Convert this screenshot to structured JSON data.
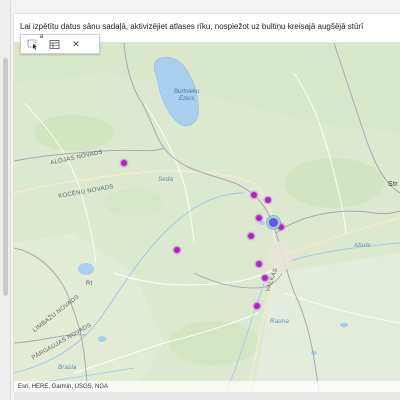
{
  "instruction": "Lai izpētītu datus sānu sadaļā, aktivizējiet atlases rīku, nospiežot uz bultiņu kreisajā augšējā stūrī",
  "toolbar": {
    "select_cursor_badge": "a",
    "items": [
      {
        "name": "select-tool",
        "icon": "selection-arrow-icon"
      },
      {
        "name": "table-tool",
        "icon": "table-icon"
      },
      {
        "name": "close-tool",
        "icon": "close-icon",
        "label": "✕"
      }
    ]
  },
  "map": {
    "labels": {
      "alojas": "ALOJAS NOVADS",
      "kocenu": "KOCĒNU NOVADS",
      "limbazu": "LIMBAŽU NOVADS",
      "pargaujas": "PĀRGAUJAS NOVADS",
      "valka": "VALKAS",
      "strenci": "Str",
      "lake": "Burtnieku\nEzers",
      "abuls": "Abuls",
      "seda": "Seda",
      "rauna": "Rauna",
      "brasla": "Brasla",
      "rt": "Rt"
    },
    "markers": [
      {
        "lat": 57.62,
        "lon": 24.95
      },
      {
        "lat": 57.55,
        "lon": 25.42
      },
      {
        "lat": 57.54,
        "lon": 25.47
      },
      {
        "lat": 57.5,
        "lon": 25.44
      },
      {
        "lat": 57.49,
        "lon": 25.5
      },
      {
        "lat": 57.48,
        "lon": 25.52
      },
      {
        "lat": 57.46,
        "lon": 25.41
      },
      {
        "lat": 57.43,
        "lon": 25.14
      },
      {
        "lat": 57.4,
        "lon": 25.44
      },
      {
        "lat": 57.37,
        "lon": 25.46
      },
      {
        "lat": 57.31,
        "lon": 25.43
      }
    ],
    "selected_marker": {
      "lat": 57.49,
      "lon": 25.49
    },
    "colors": {
      "marker": "#b023c2",
      "selected": "#6a55e8",
      "water": "#a9cfee",
      "land": "#dde9cf"
    }
  },
  "attribution": "Esri, HERE, Garmin, USGS, NGA"
}
